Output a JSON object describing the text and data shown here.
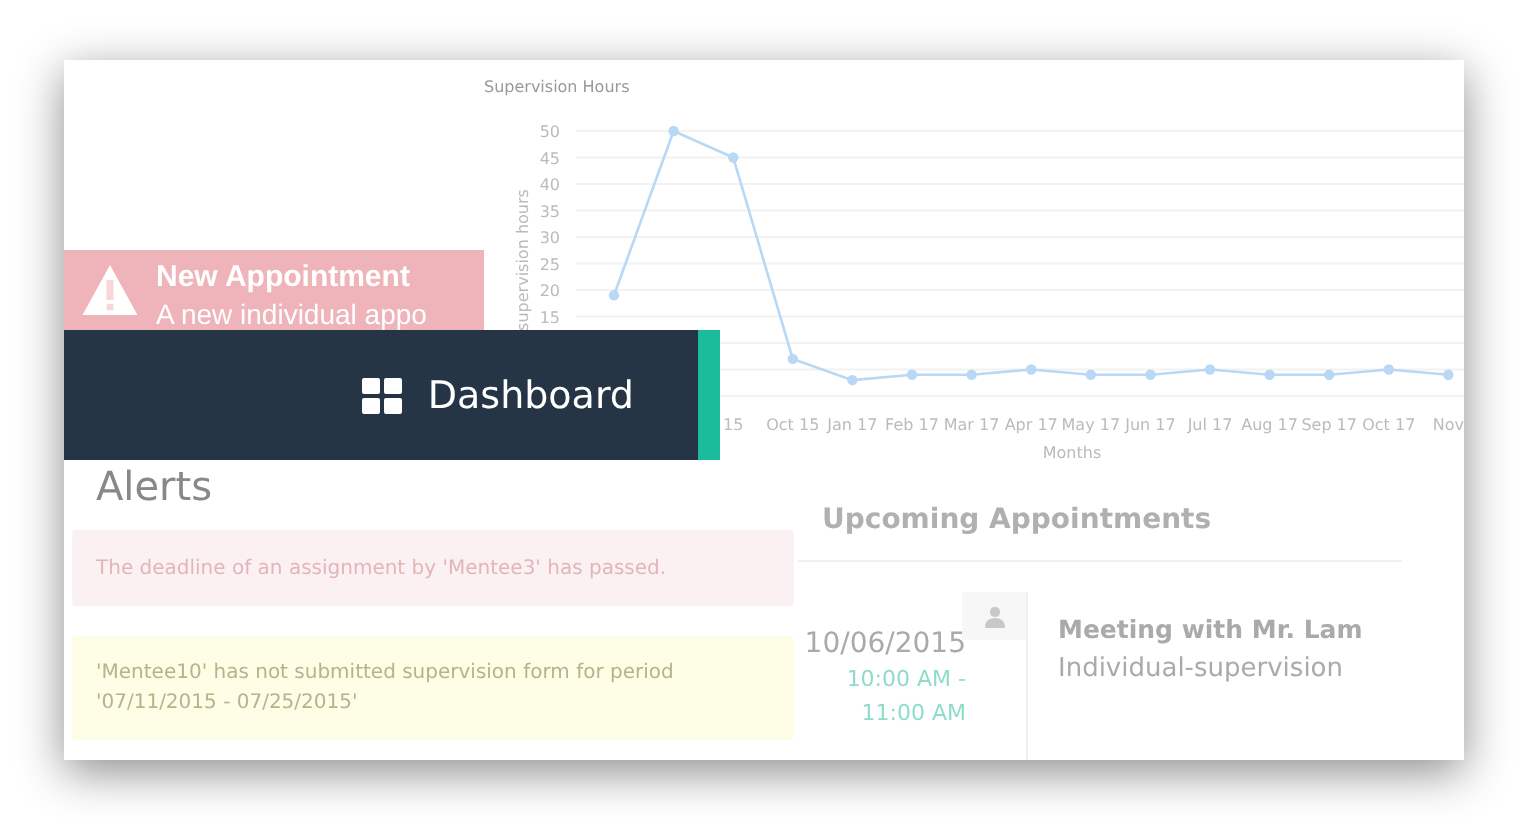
{
  "notification": {
    "title": "New Appointment",
    "text": "A new individual appo"
  },
  "chart": {
    "title": "Supervision Hours",
    "chart_data": {
      "type": "line",
      "xlabel": "Months",
      "ylabel": "supervision hours",
      "categories": [
        null,
        null,
        "15",
        "Oct 15",
        "Jan 17",
        "Feb 17",
        "Mar 17",
        "Apr 17",
        "May 17",
        "Jun 17",
        "Jul 17",
        "Aug 17",
        "Sep 17",
        "Oct 17",
        "Nov"
      ],
      "ylim": [
        0,
        50
      ],
      "grid": true,
      "yticks": [
        15,
        20,
        25,
        30,
        35,
        40,
        45,
        50
      ],
      "series": [
        {
          "marker": "circle",
          "color": "#b8d8f5",
          "values": [
            19,
            50,
            45,
            7,
            3,
            4,
            4,
            5,
            4,
            4,
            5,
            4,
            4,
            5,
            4
          ]
        }
      ]
    }
  },
  "banner": {
    "label": "Dashboard"
  },
  "alerts": {
    "title": "Alerts",
    "items": [
      {
        "kind": "danger",
        "text": "The deadline of an assignment by 'Mentee3' has passed."
      },
      {
        "kind": "warning",
        "text": "'Mentee10' has not submitted supervision form for period '07/11/2015 - 07/25/2015'"
      }
    ]
  },
  "appointments": {
    "title": "Upcoming Appointments",
    "items": [
      {
        "date": "10/06/2015",
        "time": "10:00 AM - 11:00 AM",
        "title": "Meeting with Mr. Lam",
        "type": "Individual-supervision"
      }
    ]
  }
}
